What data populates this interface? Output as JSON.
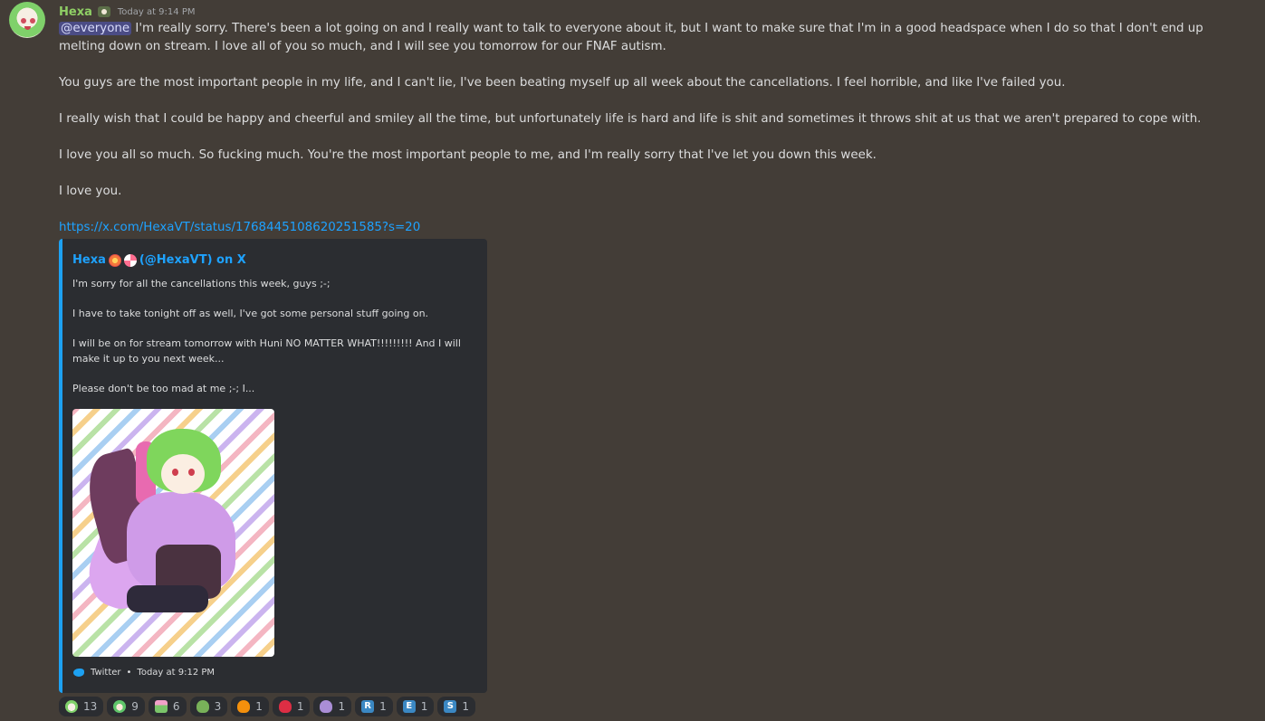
{
  "message": {
    "username": "Hexa",
    "timestamp": "Today at 9:14 PM",
    "mention": "@everyone",
    "first_paragraph": " I'm really sorry. There's been a lot going on and I really want to talk to everyone about it, but I want to make sure that I'm in a good headspace when I do so that I don't end up melting down on stream. I love all of you so much, and I will see you tomorrow for our FNAF autism.",
    "paragraphs": [
      "You guys are the most important people in my life, and I can't lie, I've been beating myself up all week about the cancellations. I feel horrible, and like I've failed you.",
      "I really wish that I could be happy and cheerful and smiley all the time, but unfortunately life is hard and life is shit and sometimes it throws shit at us that we aren't prepared to cope with.",
      "I love you all so much. So fucking much. You're the most important people to me, and I'm really sorry that I've let you down this week.",
      "I love you."
    ],
    "link": "https://x.com/HexaVT/status/1768445108620251585?s=20"
  },
  "embed": {
    "author_name": "Hexa",
    "author_handle": "(@HexaVT) on X",
    "description": [
      "I'm sorry for all the cancellations this week, guys ;-;",
      "I have to take tonight off as well, I've got some personal stuff going on.",
      "I will be on for stream tomorrow with Huni NO MATTER WHAT!!!!!!!!! And I will make it up to you next week...",
      "Please don't be too mad at me ;-; I..."
    ],
    "footer_source": "Twitter",
    "footer_separator": "•",
    "footer_time": "Today at 9:12 PM",
    "accent_color": "#1da1f2"
  },
  "reactions": [
    {
      "emoji": "hexa-face-emoji",
      "count": "13"
    },
    {
      "emoji": "hexa-chibi-emoji",
      "count": "9"
    },
    {
      "emoji": "flower-pot-emoji",
      "count": "6"
    },
    {
      "emoji": "green-heart",
      "count": "3",
      "color": "#78b159"
    },
    {
      "emoji": "orange-heart",
      "count": "1",
      "color": "#f4900c"
    },
    {
      "emoji": "red-heart",
      "count": "1",
      "color": "#dd2e44"
    },
    {
      "emoji": "purple-heart",
      "count": "1",
      "color": "#aa8ed6"
    },
    {
      "emoji": "regional-indicator-r",
      "letter": "R",
      "count": "1"
    },
    {
      "emoji": "regional-indicator-e",
      "letter": "E",
      "count": "1"
    },
    {
      "emoji": "regional-indicator-s",
      "letter": "S",
      "count": "1"
    }
  ]
}
